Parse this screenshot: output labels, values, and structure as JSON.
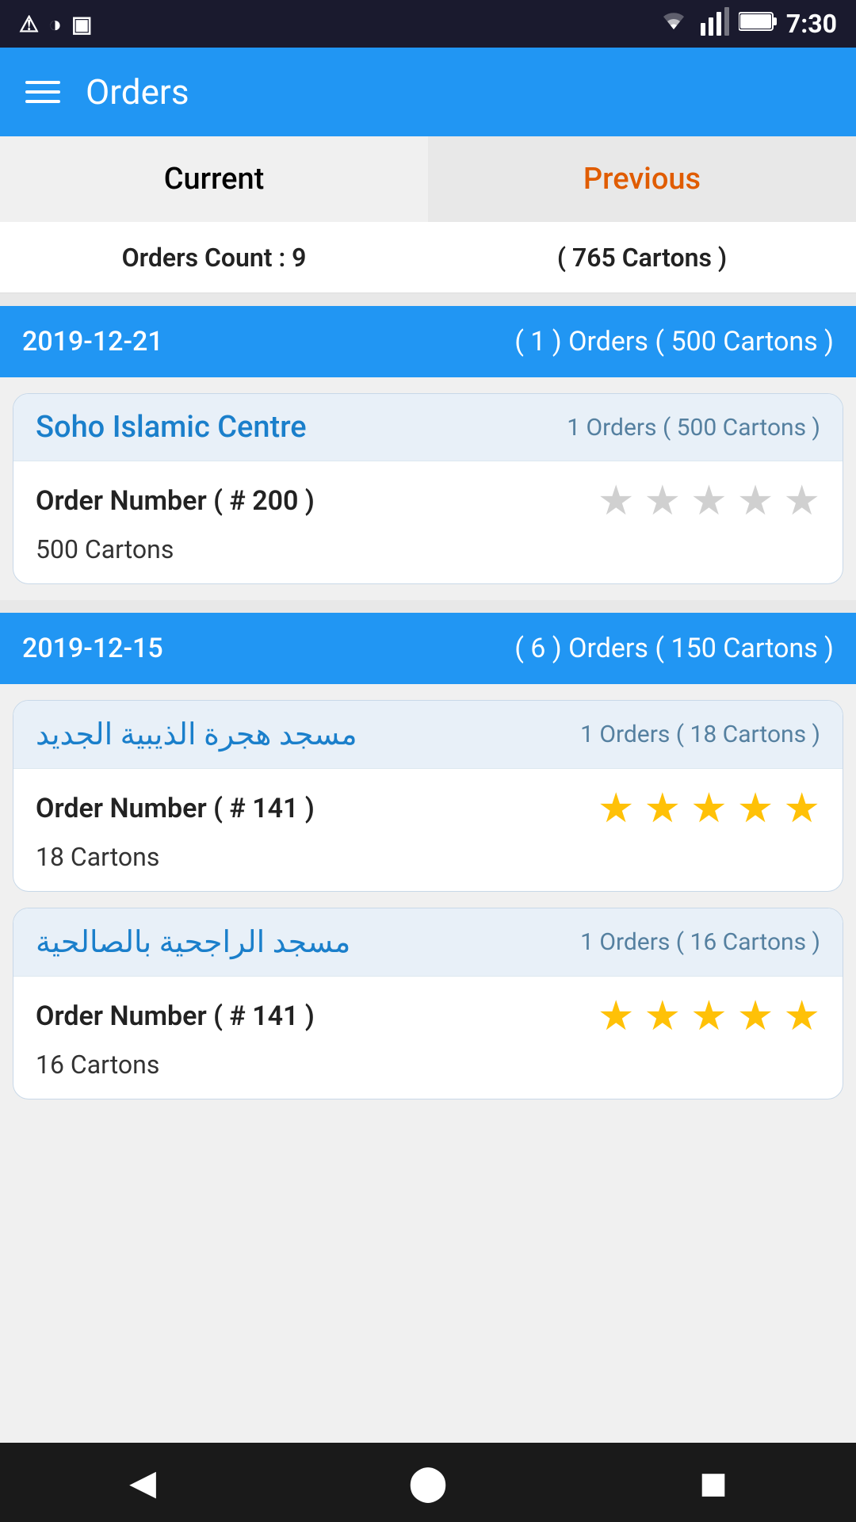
{
  "statusBar": {
    "time": "7:30",
    "icons": [
      "warning-icon",
      "sync-icon",
      "sd-card-icon",
      "wifi-icon",
      "signal-icon",
      "battery-icon"
    ]
  },
  "appBar": {
    "title": "Orders",
    "menuIcon": "menu-icon"
  },
  "tabs": [
    {
      "id": "current",
      "label": "Current",
      "active": false
    },
    {
      "id": "previous",
      "label": "Previous",
      "active": true
    }
  ],
  "summary": {
    "ordersCount": "Orders Count : 9",
    "cartonsCount": "( 765 Cartons )"
  },
  "sections": [
    {
      "date": "2019-12-21",
      "info": "( 1 ) Orders ( 500 Cartons )",
      "orders": [
        {
          "title": "Soho Islamic Centre",
          "ordersCount": "1 Orders ( 500 Cartons )",
          "orderNumber": "Order Number ( # 200 )",
          "cartons": "500 Cartons",
          "stars": 0,
          "maxStars": 5
        }
      ]
    },
    {
      "date": "2019-12-15",
      "info": "( 6 ) Orders ( 150 Cartons )",
      "orders": [
        {
          "title": "مسجد هجرة الذيبية الجديد",
          "ordersCount": "1 Orders ( 18 Cartons )",
          "orderNumber": "Order Number ( # 141 )",
          "cartons": "18 Cartons",
          "stars": 5,
          "maxStars": 5
        },
        {
          "title": "مسجد الراجحية بالصالحية",
          "ordersCount": "1 Orders ( 16 Cartons )",
          "orderNumber": "Order Number ( # 141 )",
          "cartons": "16 Cartons",
          "stars": 5,
          "maxStars": 5
        }
      ]
    }
  ],
  "navBar": {
    "back": "◀",
    "home": "⬤",
    "recent": "◼"
  }
}
